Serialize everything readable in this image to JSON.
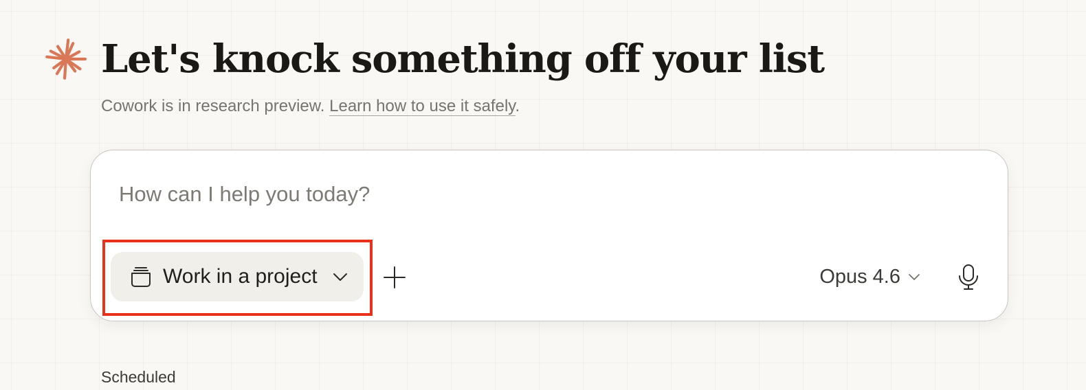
{
  "hero": {
    "title": "Let's knock something off your list",
    "subtitle_text": "Cowork is in research preview.",
    "subtitle_link": "Learn how to use it safely",
    "subtitle_end": "."
  },
  "composer": {
    "placeholder": "How can I help you today?",
    "project_button_label": "Work in a project",
    "model_label": "Opus 4.6",
    "icons": {
      "logo": "sparkle-logo-icon",
      "project": "folder-stack-icon",
      "chevron": "chevron-down-icon",
      "add": "plus-icon",
      "mic": "microphone-icon"
    }
  },
  "sections": {
    "scheduled_label": "Scheduled"
  },
  "colors": {
    "background": "#f9f8f4",
    "accent": "#d97757",
    "highlight": "#e8301a",
    "project_button_bg": "#f1efe9"
  }
}
